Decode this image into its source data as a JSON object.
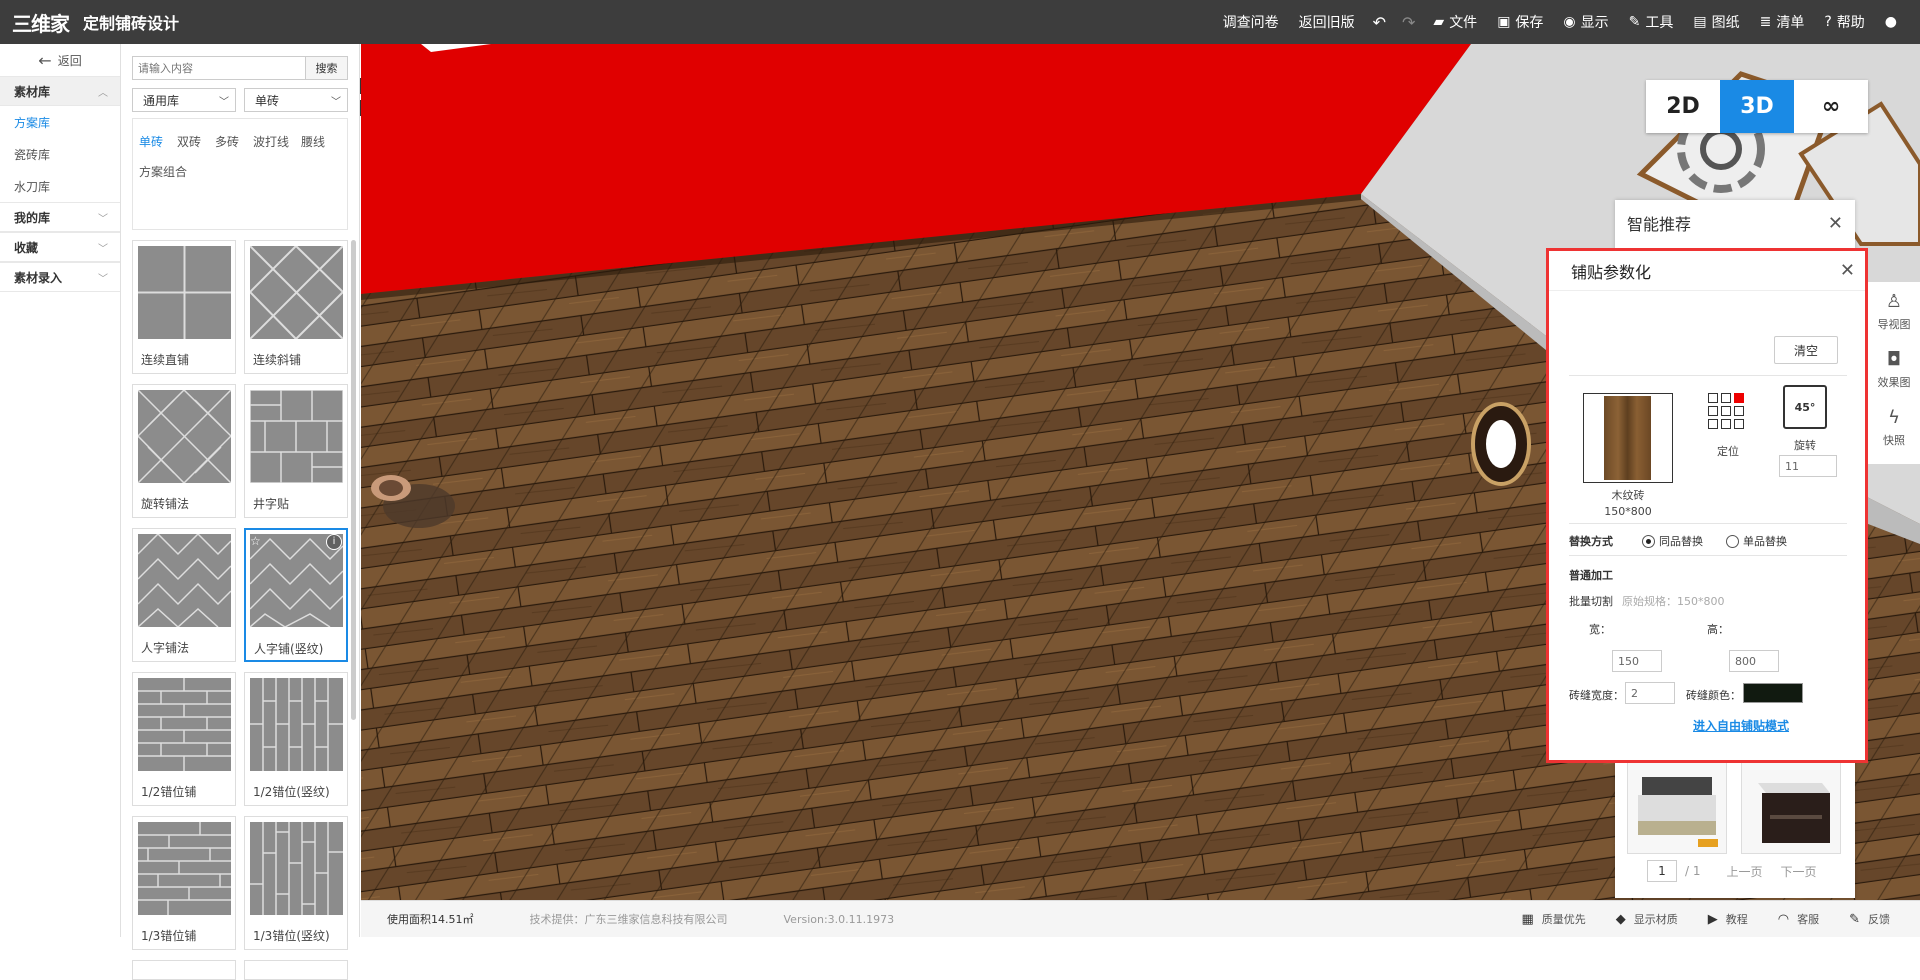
{
  "header": {
    "logo_text": "三维家",
    "app_title": "定制铺砖设计",
    "nav": {
      "survey": "调查问卷",
      "old_version": "返回旧版",
      "file": "文件",
      "save": "保存",
      "display": "显示",
      "tools": "工具",
      "drawings": "图纸",
      "list": "清单",
      "help": "帮助"
    }
  },
  "left_nav": {
    "back": "返回",
    "material_lib": "素材库",
    "items": [
      "方案库",
      "瓷砖库",
      "水刀库"
    ],
    "my_lib": "我的库",
    "favorites": "收藏",
    "material_entry": "素材录入"
  },
  "catalog": {
    "search_placeholder": "请输入内容",
    "search_btn": "搜索",
    "lib_select": "通用库",
    "type_select": "单砖",
    "filters": [
      "单砖",
      "双砖",
      "多砖",
      "波打线",
      "腰线",
      "方案组合"
    ],
    "tiles": [
      {
        "label": "连续直铺",
        "pattern": "grid"
      },
      {
        "label": "连续斜铺",
        "pattern": "diamond"
      },
      {
        "label": "旋转铺法",
        "pattern": "rotate"
      },
      {
        "label": "井字贴",
        "pattern": "basket"
      },
      {
        "label": "人字铺法",
        "pattern": "herring"
      },
      {
        "label": "人字铺(竖纹)",
        "pattern": "herring2"
      },
      {
        "label": "1/2错位铺",
        "pattern": "brick"
      },
      {
        "label": "1/2错位(竖纹)",
        "pattern": "vbrick"
      },
      {
        "label": "1/3错位铺",
        "pattern": "brick3"
      },
      {
        "label": "1/3错位(竖纹)",
        "pattern": "vbrick3"
      }
    ]
  },
  "view_tabs": [
    "2D",
    "3D",
    "∞"
  ],
  "side_tools": [
    "导视图",
    "效果图",
    "快照"
  ],
  "recommend": {
    "title": "智能推荐",
    "page": "1",
    "total": "/ 1",
    "prev": "上一页",
    "next": "下一页"
  },
  "param_panel": {
    "title": "铺贴参数化",
    "clear": "清空",
    "tile_name": "木纹砖",
    "tile_size": "150*800",
    "position": "定位",
    "rotate": "旋转",
    "rotate_badge": "45°",
    "rotate_value": "11",
    "replace_label": "替换方式",
    "replace_same": "同品替换",
    "replace_single": "单品替换",
    "processing": "普通加工",
    "batch_cut": "批量切割",
    "original_spec": "原始规格：150*800",
    "width_label": "宽：",
    "width_value": "150",
    "height_label": "高：",
    "height_value": "800",
    "gap_label": "砖缝宽度：",
    "gap_value": "2",
    "gap_color_label": "砖缝颜色：",
    "gap_color": "#111a10",
    "free_mode": "进入自由铺贴模式"
  },
  "status_bar": {
    "area": "使用面积14.51㎡",
    "provider": "技术提供：广东三维家信息科技有限公司",
    "version": "Version:3.0.11.1973",
    "quality": "质量优先",
    "show_material": "显示材质",
    "tutorial": "教程",
    "service": "客服",
    "feedback": "反馈"
  },
  "colors": {
    "accent": "#1a8ae5",
    "topbar": "#3d3d3d",
    "highlight_border": "#e33333",
    "wall_red": "#e00000"
  }
}
